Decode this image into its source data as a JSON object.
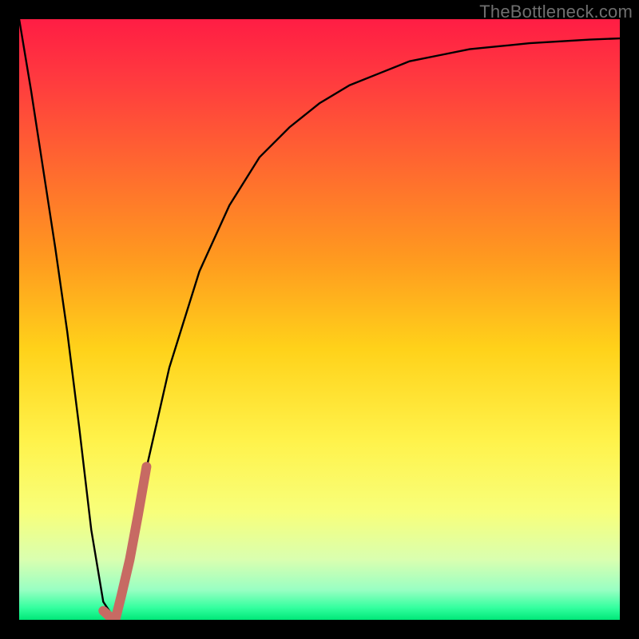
{
  "watermark": "TheBottleneck.com",
  "colors": {
    "frame": "#000000",
    "curve": "#000000",
    "highlight": "#c76a63",
    "gradient_stops": [
      {
        "offset": 0.0,
        "color": "#ff1d44"
      },
      {
        "offset": 0.1,
        "color": "#ff3a3f"
      },
      {
        "offset": 0.25,
        "color": "#ff6a2f"
      },
      {
        "offset": 0.4,
        "color": "#ff9a1f"
      },
      {
        "offset": 0.55,
        "color": "#ffd21a"
      },
      {
        "offset": 0.7,
        "color": "#fff24a"
      },
      {
        "offset": 0.82,
        "color": "#f8ff7a"
      },
      {
        "offset": 0.9,
        "color": "#d9ffb0"
      },
      {
        "offset": 0.95,
        "color": "#99ffc3"
      },
      {
        "offset": 0.98,
        "color": "#33ff9f"
      },
      {
        "offset": 1.0,
        "color": "#00e878"
      }
    ]
  },
  "chart_data": {
    "type": "line",
    "title": "",
    "xlabel": "",
    "ylabel": "",
    "xlim": [
      0,
      100
    ],
    "ylim": [
      0,
      100
    ],
    "series": [
      {
        "name": "bottleneck-curve",
        "x": [
          0,
          2,
          4,
          6,
          8,
          10,
          12,
          14,
          16,
          18,
          20,
          25,
          30,
          35,
          40,
          45,
          50,
          55,
          60,
          65,
          70,
          75,
          80,
          85,
          90,
          95,
          100
        ],
        "y": [
          100,
          88,
          75,
          62,
          48,
          32,
          15,
          3,
          0,
          8,
          20,
          42,
          58,
          69,
          77,
          82,
          86,
          89,
          91,
          93,
          94,
          95,
          95.5,
          96,
          96.3,
          96.6,
          96.8
        ]
      }
    ],
    "highlight_segment": {
      "name": "optimal-range",
      "x": [
        14.0,
        15.0,
        16.0,
        17.0,
        18.4,
        19.8,
        21.2
      ],
      "y": [
        1.5,
        0.6,
        0.0,
        4.0,
        10.0,
        17.5,
        25.5
      ]
    }
  }
}
